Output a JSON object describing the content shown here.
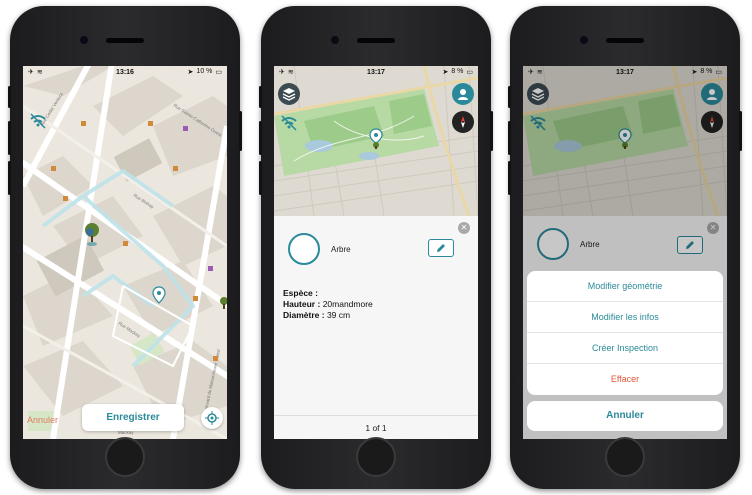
{
  "phone1": {
    "status": {
      "time": "13:16",
      "battery": "10 %"
    },
    "map": {
      "streets": [
        "Ave Cedar Ventura",
        "Rue Bishop",
        "Rue Mackay",
        "Rue Sainte-Catherine Ouest",
        "Boulevard de Maisonneuve Ouest",
        "Mackay"
      ],
      "lots": []
    },
    "bottom": {
      "cancel_label": "Annuler",
      "save_label": "Enregistrer"
    }
  },
  "phone2": {
    "status": {
      "time": "13:17",
      "battery": "8 %"
    },
    "object": {
      "type_label": "Arbre"
    },
    "attributes": [
      {
        "label": "Espèce :",
        "value": ""
      },
      {
        "label": "Hauteur :",
        "value": "20mandmore"
      },
      {
        "label": "Diamètre :",
        "value": "39 cm"
      }
    ],
    "pager": "1 of 1"
  },
  "phone3": {
    "status": {
      "time": "13:17",
      "battery": "8 %"
    },
    "object": {
      "type_label": "Arbre"
    },
    "action_sheet": {
      "items": [
        "Modifier géométrie",
        "Modifier les infos",
        "Créer Inspection",
        "Effacer"
      ],
      "cancel_label": "Annuler"
    }
  },
  "colors": {
    "accent": "#2b8a9a",
    "destructive": "#e05a3a",
    "cancel_orange": "#e07a5f"
  },
  "icons": [
    "layers-icon",
    "profile-icon",
    "compass-icon",
    "no-signal-icon",
    "pencil-icon",
    "close-icon",
    "locate-icon",
    "map-pin-icon",
    "tree-icon"
  ]
}
